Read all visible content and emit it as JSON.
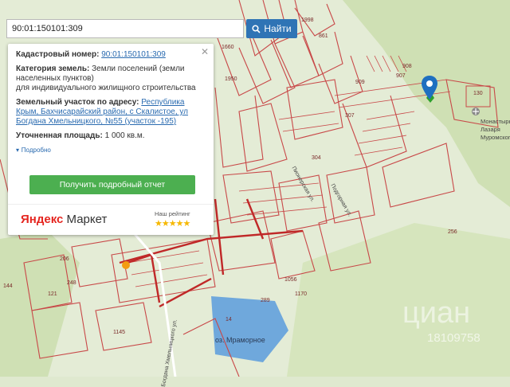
{
  "search": {
    "value": "90:01:150101:309",
    "button_label": "Найти"
  },
  "panel": {
    "cad_label": "Кадастровый номер:",
    "cad_value": "90:01:150101:309",
    "category_label": "Категория земель:",
    "category_value": "Земли поселений (земли населенных пунктов)",
    "usage": "для индивидуального жилищного строительства",
    "address_label": "Земельный участок по адресу:",
    "address_value": "Республика Крым, Бахчисарайский район, с Скалистое, ул Богдана Хмельницкого, №55 (участок -195)",
    "area_label": "Уточненная площадь:",
    "area_value": "1 000 кв.м.",
    "more_label": "Подробно",
    "report_button": "Получить подробный отчет",
    "ad_brand_ya": "Яндекс",
    "ad_brand": "Маркет",
    "rating_label": "Наш рейтинг",
    "rating_stars": "★★★★★",
    "rating_value": 5
  },
  "map": {
    "numbers": [
      "1998",
      "861",
      "1660",
      "1950",
      "908",
      "907",
      "909",
      "130",
      "307",
      "304",
      "256",
      "1056",
      "1170",
      "289",
      "14",
      "206",
      "248",
      "144",
      "121",
      "1145"
    ],
    "street_labels": [
      "Подгорная ул.",
      "Пионерская ул.",
      "Богдана Хмельницкого ул."
    ],
    "monastery": "Монастырь Лазаря Муромского",
    "lake": "оз. Мраморное",
    "watermark": "циан",
    "watermark_number": "18109758"
  },
  "colors": {
    "accent": "#2f74b5",
    "report_button": "#4caf50",
    "plot_line": "#c84848",
    "star": "#f6b800"
  }
}
